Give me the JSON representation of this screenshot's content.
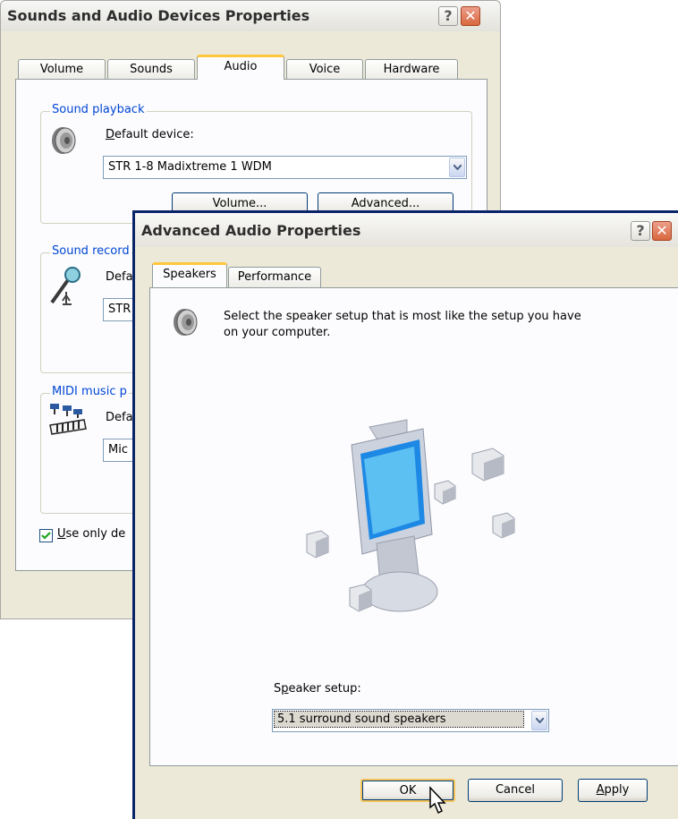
{
  "bg_window": {
    "title": "Sounds and Audio Devices Properties",
    "tabs": [
      "Volume",
      "Sounds",
      "Audio",
      "Voice",
      "Hardware"
    ],
    "active_tab": "Audio",
    "sound_playback": {
      "legend": "Sound playback",
      "default_device_prefix": "D",
      "default_device_rest": "efault device:",
      "device_value": "STR 1-8 Madixtreme 1 WDM",
      "volume_button": "Volume...",
      "advanced_button": "Advanced..."
    },
    "sound_recording": {
      "legend": "Sound record",
      "default_label": "Defa",
      "device_value": "STR"
    },
    "midi": {
      "legend": "MIDI music p",
      "default_label": "Defa",
      "device_value": "Mic"
    },
    "checkbox": {
      "checked": true,
      "label_prefix": "U",
      "label_rest": "se only de"
    }
  },
  "dialog": {
    "title": "Advanced Audio Properties",
    "tabs": [
      "Speakers",
      "Performance"
    ],
    "active_tab": "Speakers",
    "description_line1": "Select the speaker setup that is most like the setup you have",
    "description_line2": "on your computer.",
    "speaker_setup_prefix": "S",
    "speaker_setup_access": "p",
    "speaker_setup_rest": "eaker setup:",
    "speaker_setup_value": "5.1 surround sound speakers",
    "ok_button": "OK",
    "cancel_button": "Cancel",
    "apply_prefix": "A",
    "apply_rest": "pply"
  },
  "icons": [
    "speaker-icon",
    "microphone-icon",
    "midi-keyboard-icon",
    "computer-surround-illustration",
    "mouse-cursor-icon"
  ]
}
